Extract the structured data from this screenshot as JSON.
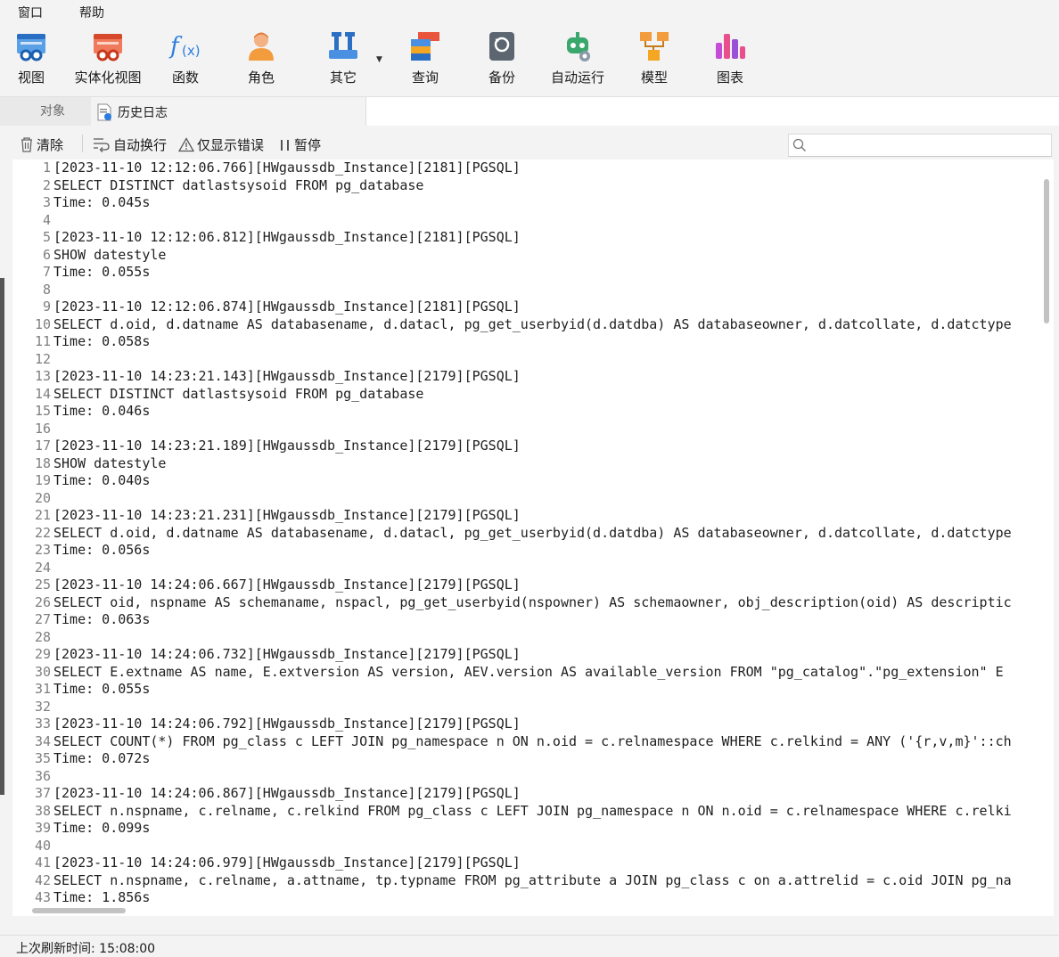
{
  "menu": {
    "window": "窗口",
    "help": "帮助"
  },
  "toolbar": {
    "view": "视图",
    "materialized_view": "实体化视图",
    "function": "函数",
    "role": "角色",
    "other": "其它",
    "query": "查询",
    "backup": "备份",
    "automation": "自动运行",
    "model": "模型",
    "chart": "图表"
  },
  "tabs": {
    "objects": "对象",
    "history_log": "历史日志"
  },
  "log_toolbar": {
    "clear": "清除",
    "auto_wrap": "自动换行",
    "errors_only": "仅显示错误",
    "pause": "暂停",
    "search_placeholder": ""
  },
  "log_lines": [
    {
      "n": "1",
      "text": "[2023-11-10 12:12:06.766][HWgaussdb_Instance][2181][PGSQL]"
    },
    {
      "n": "2",
      "text": "SELECT DISTINCT datlastsysoid FROM pg_database"
    },
    {
      "n": "3",
      "text": "Time: 0.045s"
    },
    {
      "n": "4",
      "text": ""
    },
    {
      "n": "5",
      "text": "[2023-11-10 12:12:06.812][HWgaussdb_Instance][2181][PGSQL]"
    },
    {
      "n": "6",
      "text": "SHOW datestyle"
    },
    {
      "n": "7",
      "text": "Time: 0.055s"
    },
    {
      "n": "8",
      "text": ""
    },
    {
      "n": "9",
      "text": "[2023-11-10 12:12:06.874][HWgaussdb_Instance][2181][PGSQL]"
    },
    {
      "n": "10",
      "text": "SELECT d.oid, d.datname AS databasename, d.datacl, pg_get_userbyid(d.datdba) AS databaseowner, d.datcollate, d.datctype"
    },
    {
      "n": "11",
      "text": "Time: 0.058s"
    },
    {
      "n": "12",
      "text": ""
    },
    {
      "n": "13",
      "text": "[2023-11-10 14:23:21.143][HWgaussdb_Instance][2179][PGSQL]"
    },
    {
      "n": "14",
      "text": "SELECT DISTINCT datlastsysoid FROM pg_database"
    },
    {
      "n": "15",
      "text": "Time: 0.046s"
    },
    {
      "n": "16",
      "text": ""
    },
    {
      "n": "17",
      "text": "[2023-11-10 14:23:21.189][HWgaussdb_Instance][2179][PGSQL]"
    },
    {
      "n": "18",
      "text": "SHOW datestyle"
    },
    {
      "n": "19",
      "text": "Time: 0.040s"
    },
    {
      "n": "20",
      "text": ""
    },
    {
      "n": "21",
      "text": "[2023-11-10 14:23:21.231][HWgaussdb_Instance][2179][PGSQL]"
    },
    {
      "n": "22",
      "text": "SELECT d.oid, d.datname AS databasename, d.datacl, pg_get_userbyid(d.datdba) AS databaseowner, d.datcollate, d.datctype"
    },
    {
      "n": "23",
      "text": "Time: 0.056s"
    },
    {
      "n": "24",
      "text": ""
    },
    {
      "n": "25",
      "text": "[2023-11-10 14:24:06.667][HWgaussdb_Instance][2179][PGSQL]"
    },
    {
      "n": "26",
      "text": "SELECT oid, nspname AS schemaname, nspacl, pg_get_userbyid(nspowner) AS schemaowner, obj_description(oid) AS descriptic"
    },
    {
      "n": "27",
      "text": "Time: 0.063s"
    },
    {
      "n": "28",
      "text": ""
    },
    {
      "n": "29",
      "text": "[2023-11-10 14:24:06.732][HWgaussdb_Instance][2179][PGSQL]"
    },
    {
      "n": "30",
      "text": "SELECT E.extname AS name, E.extversion AS version, AEV.version AS available_version FROM \"pg_catalog\".\"pg_extension\" E"
    },
    {
      "n": "31",
      "text": "Time: 0.055s"
    },
    {
      "n": "32",
      "text": ""
    },
    {
      "n": "33",
      "text": "[2023-11-10 14:24:06.792][HWgaussdb_Instance][2179][PGSQL]"
    },
    {
      "n": "34",
      "text": "SELECT COUNT(*) FROM pg_class c LEFT JOIN pg_namespace n ON n.oid = c.relnamespace WHERE c.relkind = ANY ('{r,v,m}'::ch"
    },
    {
      "n": "35",
      "text": "Time: 0.072s"
    },
    {
      "n": "36",
      "text": ""
    },
    {
      "n": "37",
      "text": "[2023-11-10 14:24:06.867][HWgaussdb_Instance][2179][PGSQL]"
    },
    {
      "n": "38",
      "text": "SELECT n.nspname, c.relname, c.relkind FROM pg_class c LEFT JOIN pg_namespace n ON n.oid = c.relnamespace WHERE c.relki"
    },
    {
      "n": "39",
      "text": "Time: 0.099s"
    },
    {
      "n": "40",
      "text": ""
    },
    {
      "n": "41",
      "text": "[2023-11-10 14:24:06.979][HWgaussdb_Instance][2179][PGSQL]"
    },
    {
      "n": "42",
      "text": "SELECT n.nspname, c.relname, a.attname, tp.typname FROM pg_attribute a JOIN pg_class c on a.attrelid = c.oid JOIN pg_na"
    },
    {
      "n": "43",
      "text": "Time: 1.856s"
    }
  ],
  "status": {
    "last_refresh": "上次刷新时间: 15:08:00"
  },
  "colors": {
    "accent_blue": "#2b7de1",
    "toolbar_bg": "#f3f3f3",
    "editor_bg": "#ffffff"
  }
}
